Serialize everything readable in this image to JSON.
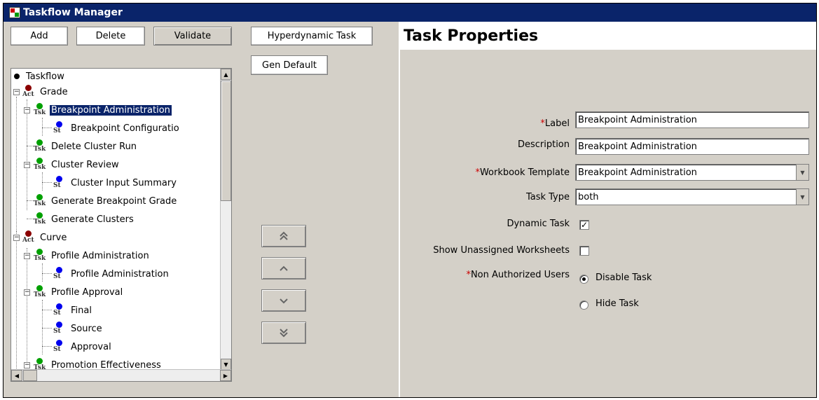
{
  "window": {
    "title": "Taskflow Manager"
  },
  "toolbar": {
    "add": "Add",
    "delete": "Delete",
    "validate": "Validate",
    "hyperdynamic": "Hyperdynamic Task",
    "gen_default": "Gen Default"
  },
  "tree": {
    "nodes": [
      {
        "label": "Taskflow",
        "kind": "root"
      },
      {
        "label": "Grade",
        "kind": "Act"
      },
      {
        "label": "Breakpoint Administration",
        "kind": "Tsk",
        "selected": true
      },
      {
        "label": "Breakpoint Configuratio",
        "kind": "St"
      },
      {
        "label": "Delete Cluster Run",
        "kind": "Tsk"
      },
      {
        "label": "Cluster Review",
        "kind": "Tsk"
      },
      {
        "label": "Cluster Input Summary",
        "kind": "St"
      },
      {
        "label": "Generate Breakpoint Grade",
        "kind": "Tsk"
      },
      {
        "label": "Generate Clusters",
        "kind": "Tsk"
      },
      {
        "label": "Curve",
        "kind": "Act"
      },
      {
        "label": "Profile Administration",
        "kind": "Tsk"
      },
      {
        "label": "Profile Administration",
        "kind": "St"
      },
      {
        "label": "Profile Approval",
        "kind": "Tsk"
      },
      {
        "label": "Final",
        "kind": "St"
      },
      {
        "label": "Source",
        "kind": "St"
      },
      {
        "label": "Approval",
        "kind": "St"
      },
      {
        "label": "Promotion Effectiveness",
        "kind": "Tsk"
      }
    ]
  },
  "move_buttons": {
    "top": "double-up-chevron-icon",
    "up": "up-chevron-icon",
    "down": "down-chevron-icon",
    "bottom": "double-down-chevron-icon"
  },
  "properties": {
    "title": "Task Properties",
    "label_field": {
      "label": "Label",
      "required_mark": "*",
      "value": "Breakpoint Administration"
    },
    "description_field": {
      "label": "Description",
      "value": "Breakpoint Administration"
    },
    "workbook_field": {
      "label": "Workbook Template",
      "required_mark": "*",
      "value": "Breakpoint Administration"
    },
    "tasktype_field": {
      "label": "Task Type",
      "value": "both"
    },
    "dynamic_task": {
      "label": "Dynamic Task",
      "checked": true,
      "mark": "✓"
    },
    "show_unassigned": {
      "label": "Show Unassigned Worksheets",
      "checked": false
    },
    "non_authorized": {
      "label": "Non Authorized Users",
      "required_mark": "*",
      "options": [
        "Disable Task",
        "Hide Task"
      ],
      "selected": "Disable Task"
    }
  }
}
